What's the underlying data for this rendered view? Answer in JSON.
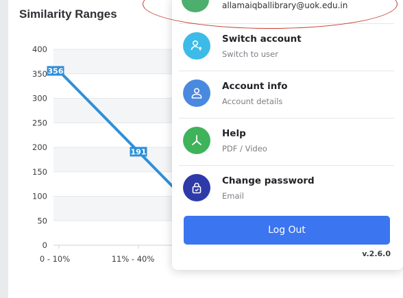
{
  "chart_data": {
    "type": "line",
    "title": "Similarity Ranges",
    "categories": [
      "0 - 10%",
      "11% - 40%"
    ],
    "series": [
      {
        "values": [
          356,
          191
        ],
        "color": "#2f8fd8"
      }
    ],
    "yticks": [
      "0",
      "50",
      "100",
      "150",
      "200",
      "250",
      "300",
      "350",
      "400"
    ],
    "ylim": [
      0,
      400
    ],
    "data_labels": [
      "356",
      "191"
    ],
    "grid": true
  },
  "account_menu": {
    "email": "allamaiqballibrary@uok.edu.in",
    "items": [
      {
        "title": "Switch account",
        "subtitle": "Switch to user",
        "icon": "switch-user-icon",
        "color": "#3dbbe8"
      },
      {
        "title": "Account info",
        "subtitle": "Account details",
        "icon": "user-icon",
        "color": "#4a89e0"
      },
      {
        "title": "Help",
        "subtitle": "PDF / Video",
        "icon": "help-hub-icon",
        "color": "#3eb35a"
      },
      {
        "title": "Change password",
        "subtitle": "Email",
        "icon": "lock-icon",
        "color": "#2e3aa8"
      }
    ],
    "logout_label": "Log Out",
    "version": "v.2.6.0"
  }
}
